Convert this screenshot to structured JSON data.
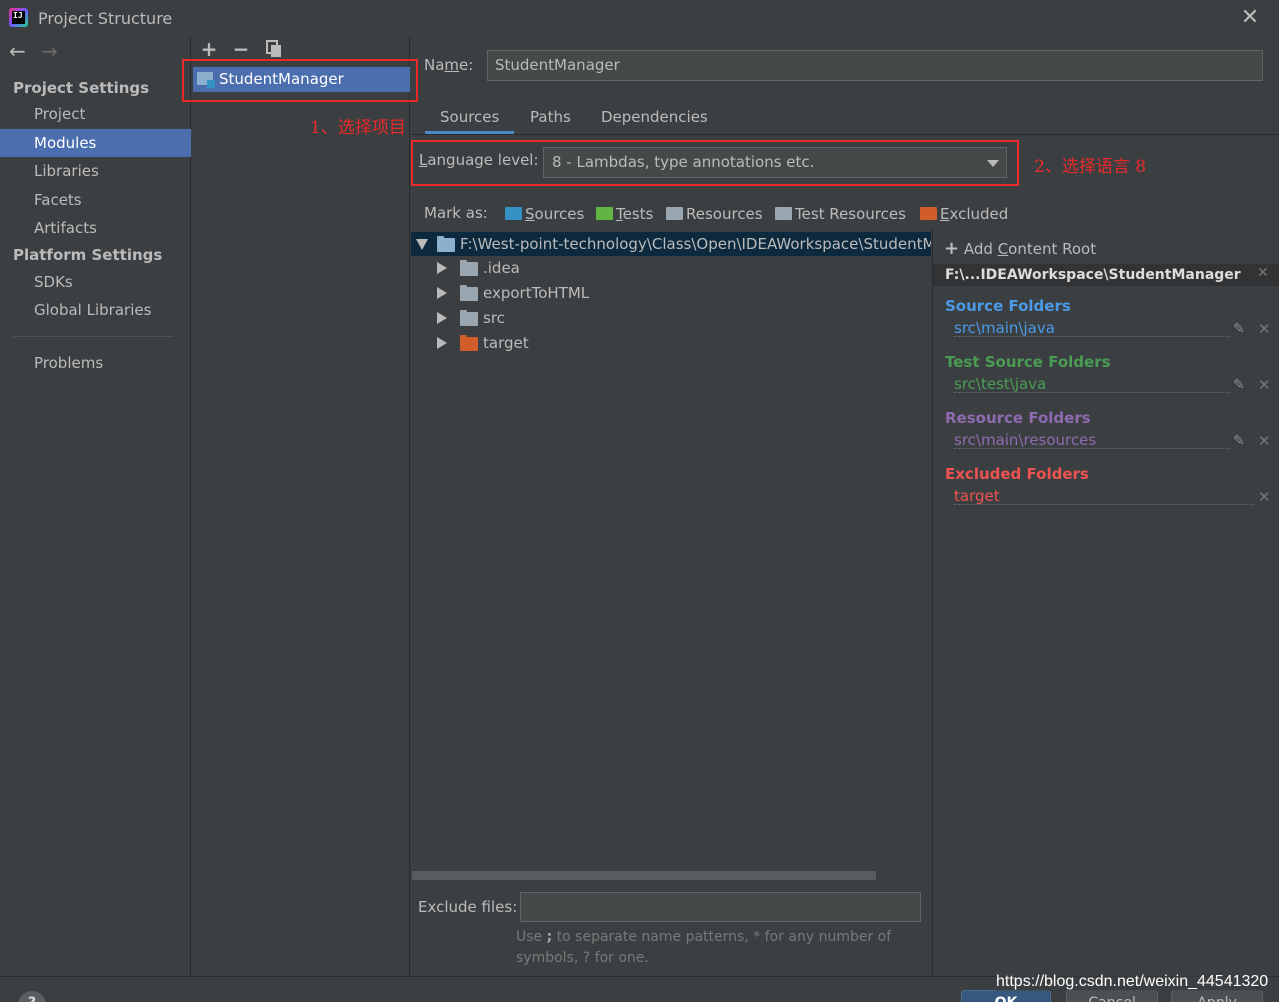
{
  "window": {
    "title": "Project Structure"
  },
  "app_logo": "IJ",
  "sidebar": {
    "project_settings": "Project Settings",
    "items1": [
      "Project",
      "Modules",
      "Libraries",
      "Facets",
      "Artifacts"
    ],
    "platform_settings": "Platform Settings",
    "items2": [
      "SDKs",
      "Global Libraries"
    ],
    "problems": "Problems",
    "selected": "Modules"
  },
  "modules": {
    "toolbar": {
      "add": "+",
      "remove": "−"
    },
    "items": [
      "StudentManager"
    ]
  },
  "annotations": {
    "step1": "1、选择项目",
    "step2": "2、选择语言 8"
  },
  "editor": {
    "name_label_pre": "Na",
    "name_label_u": "m",
    "name_label_post": "e:",
    "name_value": "StudentManager",
    "tabs": [
      "Sources",
      "Paths",
      "Dependencies"
    ],
    "active_tab": "Sources",
    "language_label_u": "L",
    "language_label_post": "anguage level:",
    "language_value": "8 - Lambdas, type annotations etc.",
    "mark_as": "Mark as:",
    "marks": [
      {
        "u": "S",
        "rest": "ources",
        "color": "#3592c4"
      },
      {
        "u": "T",
        "rest": "ests",
        "color": "#62b543"
      },
      {
        "u": "",
        "rest": "Resources",
        "color": "#9aa7b0"
      },
      {
        "u": "",
        "rest": "Test Resources",
        "color": "#9aa7b0"
      },
      {
        "u": "E",
        "rest": "xcluded",
        "color": "#d15e2a"
      }
    ]
  },
  "tree": {
    "root": "F:\\West-point-technology\\Class\\Open\\IDEAWorkspace\\StudentManager",
    "children": [
      {
        "name": ".idea",
        "color": "#9aa7b0"
      },
      {
        "name": "exportToHTML",
        "color": "#9aa7b0"
      },
      {
        "name": "src",
        "color": "#9aa7b0"
      },
      {
        "name": "target",
        "color": "#d15e2a"
      }
    ]
  },
  "exclude": {
    "label": "Exclude files:",
    "value": "",
    "hint_pre": "Use ",
    "hint_bold": ";",
    "hint_mid": " to separate name patterns, ",
    "hint_star": "*",
    "hint_mid2": " for any number of symbols, ",
    "hint_q": "?",
    "hint_post": " for one."
  },
  "content_root": {
    "add_label_pre": "Add ",
    "add_label_u": "C",
    "add_label_post": "ontent Root",
    "root_path": "F:\\...IDEAWorkspace\\StudentManager",
    "groups": [
      {
        "title": "Source Folders",
        "path": "src\\main\\java",
        "title_color": "#4a9ae8",
        "path_color": "#4a9ae8",
        "editable": true
      },
      {
        "title": "Test Source Folders",
        "path": "src\\test\\java",
        "title_color": "#499c54",
        "path_color": "#499c54",
        "editable": true
      },
      {
        "title": "Resource Folders",
        "path": "src\\main\\resources",
        "title_color": "#8e6bb0",
        "path_color": "#8e6bb0",
        "editable": true
      },
      {
        "title": "Excluded Folders",
        "path": "target",
        "title_color": "#ef5350",
        "path_color": "#ef5350",
        "editable": false
      }
    ]
  },
  "footer": {
    "help": "?",
    "ok": "OK",
    "cancel": "Cancel",
    "apply": "Apply"
  },
  "watermark": "https://blog.csdn.net/weixin_44541320"
}
